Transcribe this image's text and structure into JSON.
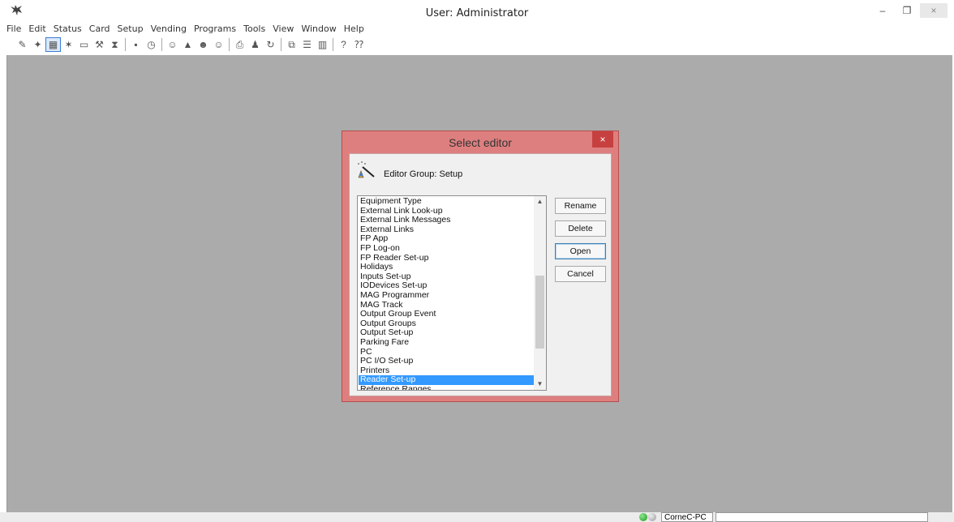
{
  "window": {
    "title": "User: Administrator",
    "minimize_glyph": "–",
    "restore_glyph": "❐",
    "close_glyph": "×"
  },
  "menu": [
    "File",
    "Edit",
    "Status",
    "Card",
    "Setup",
    "Vending",
    "Programs",
    "Tools",
    "View",
    "Window",
    "Help"
  ],
  "toolbar_icons": [
    {
      "icon": "broom-icon",
      "glyph": "✎"
    },
    {
      "icon": "magic-wand-icon",
      "glyph": "✦"
    },
    {
      "icon": "editor-icon",
      "glyph": "▦",
      "active": true
    },
    {
      "icon": "setup-wizard-icon",
      "glyph": "✶"
    },
    {
      "icon": "monitor-icon",
      "glyph": "▭"
    },
    {
      "icon": "config-icon",
      "glyph": "⚒"
    },
    {
      "icon": "hourglass-icon",
      "glyph": "⧗"
    },
    {
      "sep": true
    },
    {
      "icon": "save-icon",
      "glyph": "▪"
    },
    {
      "icon": "clock-icon",
      "glyph": "◷"
    },
    {
      "sep": true
    },
    {
      "icon": "user-icon",
      "glyph": "☺"
    },
    {
      "icon": "lock-icon",
      "glyph": "▲"
    },
    {
      "icon": "users-icon",
      "glyph": "☻"
    },
    {
      "icon": "user-search-icon",
      "glyph": "☺"
    },
    {
      "sep": true
    },
    {
      "icon": "printer-icon",
      "glyph": "⎙"
    },
    {
      "icon": "person-icon",
      "glyph": "♟"
    },
    {
      "icon": "refresh-icon",
      "glyph": "↻"
    },
    {
      "sep": true
    },
    {
      "icon": "cascade-icon",
      "glyph": "⧉"
    },
    {
      "icon": "tile-horizontal-icon",
      "glyph": "☰"
    },
    {
      "icon": "tile-vertical-icon",
      "glyph": "▥"
    },
    {
      "sep": true
    },
    {
      "icon": "help-icon",
      "glyph": "?"
    },
    {
      "icon": "context-help-icon",
      "glyph": "⁇"
    }
  ],
  "status": {
    "pc_name": "CorneC-PC"
  },
  "dialog": {
    "title": "Select editor",
    "close_glyph": "×",
    "group_label": "Editor Group: Setup",
    "list": {
      "items": [
        "Equipment Type",
        "External Link Look-up",
        "External Link Messages",
        "External Links",
        "FP App",
        "FP Log-on",
        "FP Reader Set-up",
        "Holidays",
        "Inputs Set-up",
        "IODevices Set-up",
        "MAG Programmer",
        "MAG Track",
        "Output Group Event",
        "Output Groups",
        "Output Set-up",
        "Parking Fare",
        "PC",
        "PC I/O Set-up",
        "Printers",
        "Reader Set-up",
        "Reference Ranges"
      ],
      "selected": "Reader Set-up",
      "scroll_up_glyph": "▲",
      "scroll_down_glyph": "▼"
    },
    "buttons": {
      "rename": "Rename",
      "delete": "Delete",
      "open": "Open",
      "cancel": "Cancel"
    }
  }
}
